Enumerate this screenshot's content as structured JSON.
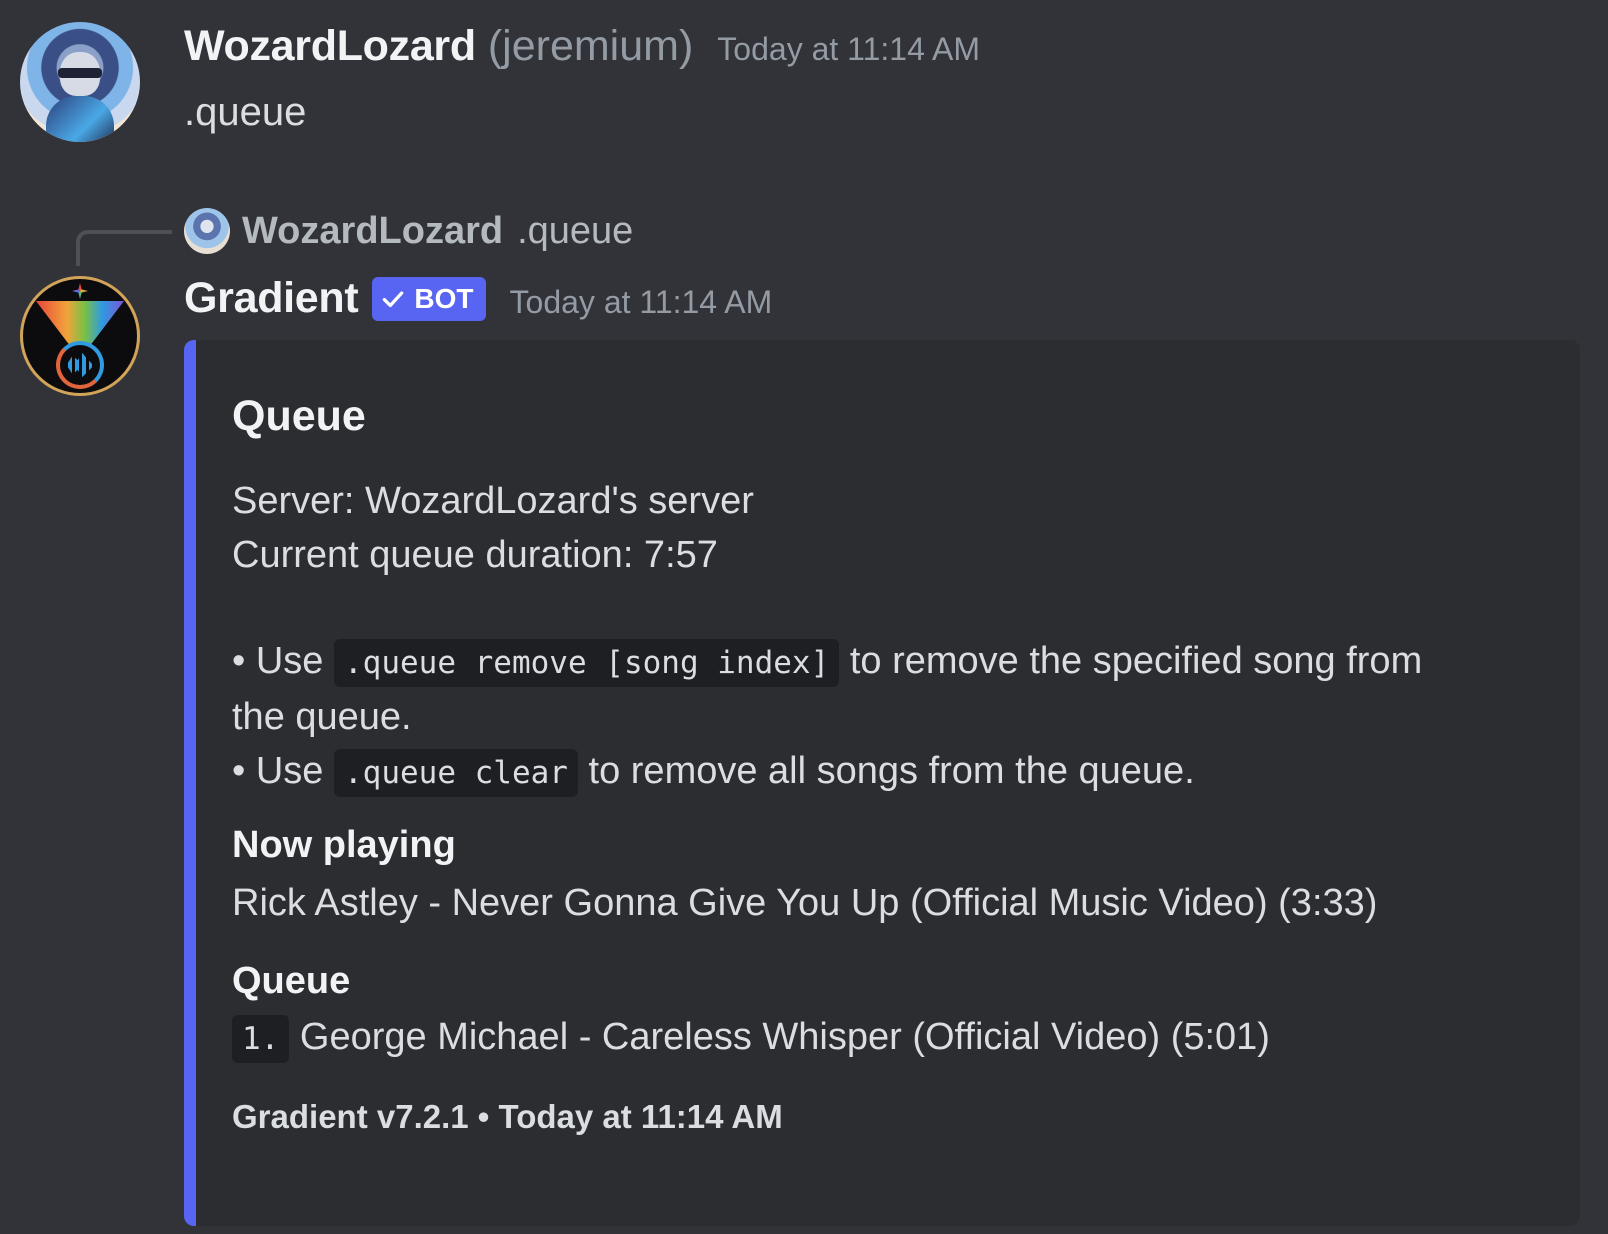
{
  "messages": [
    {
      "author": "WozardLozard",
      "nickname": "(jeremium)",
      "timestamp": "Today at 11:14 AM",
      "content": ".queue",
      "avatar_icon": "anime-character-avatar"
    },
    {
      "reply_to": {
        "author": "WozardLozard",
        "content": ".queue"
      },
      "author": "Gradient",
      "badge": "BOT",
      "badge_color": "#5865f2",
      "timestamp": "Today at 11:14 AM",
      "avatar_icon": "gradient-bot-logo",
      "embed": {
        "accent_color": "#5865f2",
        "title": "Queue",
        "server_line": "Server: WozardLozard's server",
        "duration_line": "Current queue duration: 7:57",
        "bullet1_prefix": "• Use ",
        "bullet1_code": ".queue remove [song index]",
        "bullet1_suffix": " to remove the specified song from",
        "bullet1_wrap": "the queue.",
        "bullet2_prefix": "• Use ",
        "bullet2_code": ".queue clear",
        "bullet2_suffix": " to remove all songs from the queue.",
        "fields": [
          {
            "name": "Now playing",
            "value": "Rick Astley - Never Gonna Give You Up (Official Music Video) (3:33)"
          },
          {
            "name": "Queue",
            "index_code": "1.",
            "value": " George Michael - Careless Whisper (Official Video) (5:01)"
          }
        ],
        "footer": "Gradient v7.2.1 • Today at 11:14 AM"
      }
    }
  ]
}
